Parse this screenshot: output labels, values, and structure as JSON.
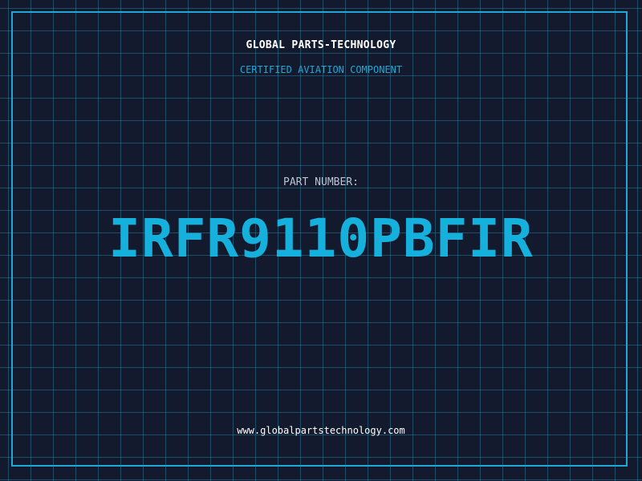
{
  "header": {
    "brand": "GLOBAL PARTS-TECHNOLOGY",
    "subtitle": "CERTIFIED AVIATION COMPONENT"
  },
  "main": {
    "label": "PART NUMBER:",
    "part_number": "IRFR9110PBFIR"
  },
  "footer": {
    "url": "www.globalpartstechnology.com"
  },
  "colors": {
    "background": "#131a2e",
    "grid": "#26788f",
    "accent": "#16b0dd",
    "frame": "#1fa8d6",
    "text": "#ffffff",
    "muted_text": "#b9c3d1"
  }
}
